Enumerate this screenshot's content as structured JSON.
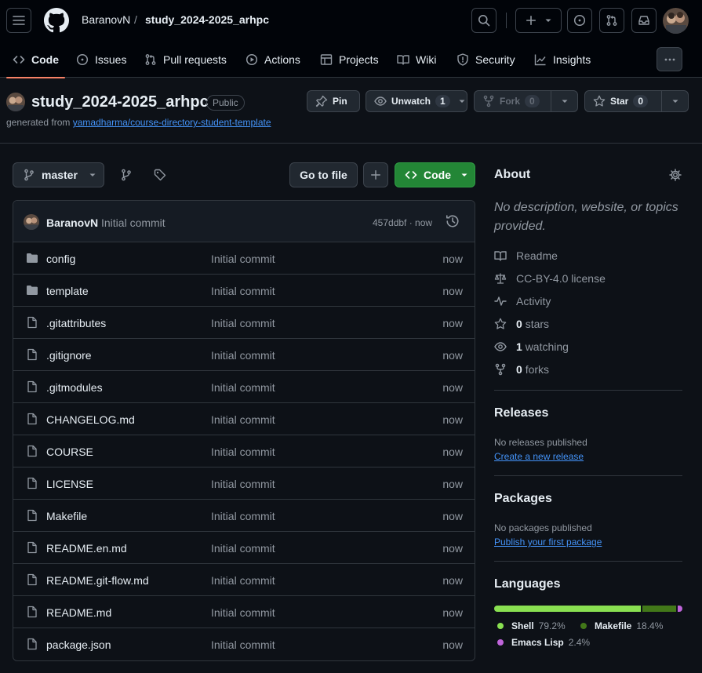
{
  "header": {
    "owner": "BaranovN",
    "separator": "/",
    "repo": "study_2024-2025_arhpc"
  },
  "tabs": [
    {
      "label": "Code",
      "icon": "code-icon",
      "active": true
    },
    {
      "label": "Issues",
      "icon": "issue-opened-icon"
    },
    {
      "label": "Pull requests",
      "icon": "git-pull-request-icon"
    },
    {
      "label": "Actions",
      "icon": "play-icon"
    },
    {
      "label": "Projects",
      "icon": "table-icon"
    },
    {
      "label": "Wiki",
      "icon": "book-icon"
    },
    {
      "label": "Security",
      "icon": "shield-icon"
    },
    {
      "label": "Insights",
      "icon": "graph-icon"
    }
  ],
  "repo": {
    "name": "study_2024-2025_arhpc",
    "visibility": "Public",
    "generated_prefix": "generated from",
    "template_link": "yamadharma/course-directory-student-template"
  },
  "actions": {
    "pin": "Pin",
    "unwatch": "Unwatch",
    "watch_count": "1",
    "fork": "Fork",
    "fork_count": "0",
    "star": "Star",
    "star_count": "0"
  },
  "toolbar": {
    "branch": "master",
    "go_to_file": "Go to file",
    "code": "Code"
  },
  "commit": {
    "author": "BaranovN",
    "message": "Initial commit",
    "hash": "457ddbf · now"
  },
  "files": [
    {
      "name": "config",
      "type": "dir",
      "message": "Initial commit",
      "time": "now"
    },
    {
      "name": "template",
      "type": "dir",
      "message": "Initial commit",
      "time": "now"
    },
    {
      "name": ".gitattributes",
      "type": "file",
      "message": "Initial commit",
      "time": "now"
    },
    {
      "name": ".gitignore",
      "type": "file",
      "message": "Initial commit",
      "time": "now"
    },
    {
      "name": ".gitmodules",
      "type": "file",
      "message": "Initial commit",
      "time": "now"
    },
    {
      "name": "CHANGELOG.md",
      "type": "file",
      "message": "Initial commit",
      "time": "now"
    },
    {
      "name": "COURSE",
      "type": "file",
      "message": "Initial commit",
      "time": "now"
    },
    {
      "name": "LICENSE",
      "type": "file",
      "message": "Initial commit",
      "time": "now"
    },
    {
      "name": "Makefile",
      "type": "file",
      "message": "Initial commit",
      "time": "now"
    },
    {
      "name": "README.en.md",
      "type": "file",
      "message": "Initial commit",
      "time": "now"
    },
    {
      "name": "README.git-flow.md",
      "type": "file",
      "message": "Initial commit",
      "time": "now"
    },
    {
      "name": "README.md",
      "type": "file",
      "message": "Initial commit",
      "time": "now"
    },
    {
      "name": "package.json",
      "type": "file",
      "message": "Initial commit",
      "time": "now"
    }
  ],
  "about": {
    "title": "About",
    "description": "No description, website, or topics provided.",
    "readme": "Readme",
    "license": "CC-BY-4.0 license",
    "activity": "Activity",
    "stars_count": "0",
    "stars_label": "stars",
    "watching_count": "1",
    "watching_label": "watching",
    "forks_count": "0",
    "forks_label": "forks"
  },
  "releases": {
    "title": "Releases",
    "empty": "No releases published",
    "link": "Create a new release"
  },
  "packages": {
    "title": "Packages",
    "empty": "No packages published",
    "link": "Publish your first package"
  },
  "languages": {
    "title": "Languages",
    "items": [
      {
        "name": "Shell",
        "percent": "79.2%",
        "value": 79.2,
        "color": "#89e051"
      },
      {
        "name": "Makefile",
        "percent": "18.4%",
        "value": 18.4,
        "color": "#427819"
      },
      {
        "name": "Emacs Lisp",
        "percent": "2.4%",
        "value": 2.4,
        "color": "#c065db"
      }
    ]
  },
  "colors": {
    "accent_tab": "#f78166",
    "primary_button": "#238636",
    "link": "#4493f8"
  }
}
